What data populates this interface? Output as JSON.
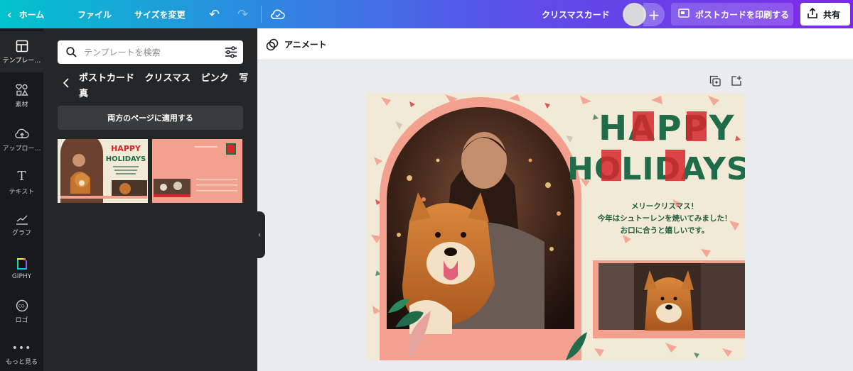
{
  "topbar": {
    "home_label": "ホーム",
    "file_label": "ファイル",
    "resize_label": "サイズを変更",
    "design_title": "クリスマスカード",
    "print_label": "ポストカードを印刷する",
    "share_label": "共有"
  },
  "rail": {
    "items": [
      {
        "label": "テンプレー…",
        "icon": "template-icon"
      },
      {
        "label": "素材",
        "icon": "elements-icon"
      },
      {
        "label": "アップロー…",
        "icon": "upload-icon"
      },
      {
        "label": "テキスト",
        "icon": "text-icon"
      },
      {
        "label": "グラフ",
        "icon": "chart-icon"
      },
      {
        "label": "GIPHY",
        "icon": "giphy-icon"
      },
      {
        "label": "ロゴ",
        "icon": "logo-icon"
      },
      {
        "label": "もっと見る",
        "icon": "more-icon"
      }
    ]
  },
  "panel": {
    "search_placeholder": "テンプレートを検索",
    "breadcrumb": "ポストカード クリスマス ピンク 写真",
    "apply_button": "両方のページに適用する"
  },
  "canvas": {
    "animate_label": "アニメート",
    "card": {
      "headline_1": "HAPPY",
      "headline_2": "HOLIDAYS",
      "greeting_lines": [
        "メリークリスマス！",
        "今年はシュトーレンを焼いてみました！",
        "お口に合うと嬉しいです。"
      ]
    }
  },
  "colors": {
    "card_green": "#1f6b4a",
    "card_red": "#d8262b",
    "card_cream": "#f1ead6",
    "card_pink": "#f4a08f"
  }
}
